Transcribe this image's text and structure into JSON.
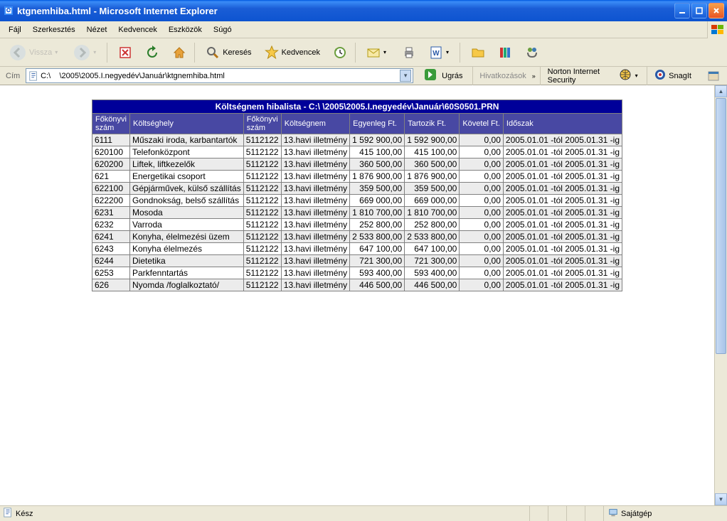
{
  "window": {
    "title": "ktgnemhiba.html - Microsoft Internet Explorer"
  },
  "menu": [
    "Fájl",
    "Szerkesztés",
    "Nézet",
    "Kedvencek",
    "Eszközök",
    "Súgó"
  ],
  "toolbar": {
    "back": "Vissza",
    "search": "Keresés",
    "favorites": "Kedvencek"
  },
  "address": {
    "label": "Cím",
    "value": "C:\\    \\2005\\2005.I.negyedév\\Január\\ktgnemhiba.html",
    "go": "Ugrás",
    "links": "Hivatkozások",
    "norton": "Norton Internet Security",
    "snagit": "SnagIt"
  },
  "table": {
    "title": "Költségnem hibalista - C:\\     \\2005\\2005.I.negyedév\\Január\\60S0501.PRN",
    "headers": [
      "Főkönyvi szám",
      "Költséghely",
      "Főkönyvi szám",
      "Költségnem",
      "Egyenleg Ft.",
      "Tartozik Ft.",
      "Követel Ft.",
      "Időszak"
    ],
    "rows": [
      [
        "6111",
        "Műszaki iroda, karbantartók",
        "5112122",
        "13.havi illetmény",
        "1 592 900,00",
        "1 592 900,00",
        "0,00",
        "2005.01.01 -tól 2005.01.31 -ig"
      ],
      [
        "620100",
        "Telefonközpont",
        "5112122",
        "13.havi illetmény",
        "415 100,00",
        "415 100,00",
        "0,00",
        "2005.01.01 -tól 2005.01.31 -ig"
      ],
      [
        "620200",
        "Liftek, liftkezelők",
        "5112122",
        "13.havi illetmény",
        "360 500,00",
        "360 500,00",
        "0,00",
        "2005.01.01 -tól 2005.01.31 -ig"
      ],
      [
        "621",
        "Energetikai csoport",
        "5112122",
        "13.havi illetmény",
        "1 876 900,00",
        "1 876 900,00",
        "0,00",
        "2005.01.01 -tól 2005.01.31 -ig"
      ],
      [
        "622100",
        "Gépjárművek, külső szállítás",
        "5112122",
        "13.havi illetmény",
        "359 500,00",
        "359 500,00",
        "0,00",
        "2005.01.01 -tól 2005.01.31 -ig"
      ],
      [
        "622200",
        "Gondnokság, belső szállítás",
        "5112122",
        "13.havi illetmény",
        "669 000,00",
        "669 000,00",
        "0,00",
        "2005.01.01 -tól 2005.01.31 -ig"
      ],
      [
        "6231",
        "Mosoda",
        "5112122",
        "13.havi illetmény",
        "1 810 700,00",
        "1 810 700,00",
        "0,00",
        "2005.01.01 -tól 2005.01.31 -ig"
      ],
      [
        "6232",
        "Varroda",
        "5112122",
        "13.havi illetmény",
        "252 800,00",
        "252 800,00",
        "0,00",
        "2005.01.01 -tól 2005.01.31 -ig"
      ],
      [
        "6241",
        "Konyha, élelmezési üzem",
        "5112122",
        "13.havi illetmény",
        "2 533 800,00",
        "2 533 800,00",
        "0,00",
        "2005.01.01 -tól 2005.01.31 -ig"
      ],
      [
        "6243",
        "Konyha élelmezés",
        "5112122",
        "13.havi illetmény",
        "647 100,00",
        "647 100,00",
        "0,00",
        "2005.01.01 -tól 2005.01.31 -ig"
      ],
      [
        "6244",
        "Dietetika",
        "5112122",
        "13.havi illetmény",
        "721 300,00",
        "721 300,00",
        "0,00",
        "2005.01.01 -tól 2005.01.31 -ig"
      ],
      [
        "6253",
        "Parkfenntartás",
        "5112122",
        "13.havi illetmény",
        "593 400,00",
        "593 400,00",
        "0,00",
        "2005.01.01 -tól 2005.01.31 -ig"
      ],
      [
        "626",
        "Nyomda /foglalkoztató/",
        "5112122",
        "13.havi illetmény",
        "446 500,00",
        "446 500,00",
        "0,00",
        "2005.01.01 -tól 2005.01.31 -ig"
      ]
    ]
  },
  "status": {
    "ready": "Kész",
    "zone": "Sajátgép"
  }
}
